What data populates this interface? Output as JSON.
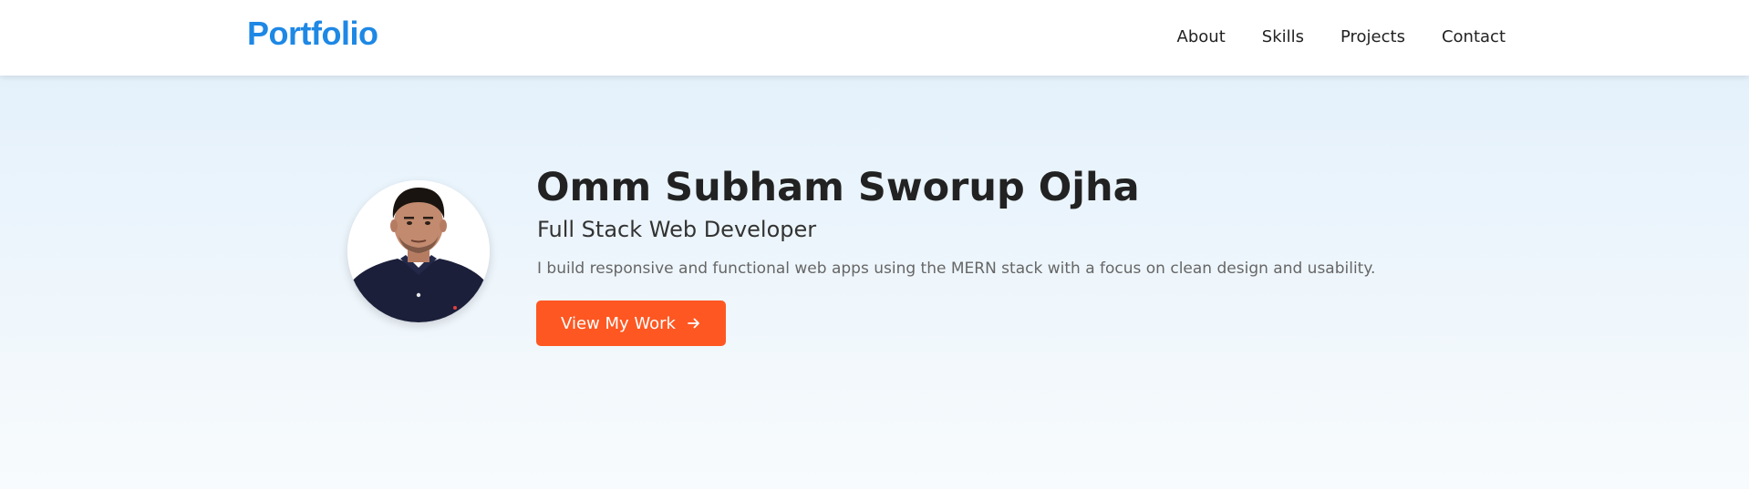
{
  "navbar": {
    "brand": "Portfolio",
    "links": [
      {
        "label": "About"
      },
      {
        "label": "Skills"
      },
      {
        "label": "Projects"
      },
      {
        "label": "Contact"
      }
    ]
  },
  "hero": {
    "name": "Omm Subham Sworup Ojha",
    "role": "Full Stack Web Developer",
    "description": "I build responsive and functional web apps using the MERN stack with a focus on clean design and usability.",
    "cta_label": "View My Work",
    "cta_icon": "arrow-right-icon",
    "avatar_alt": "profile photo"
  },
  "colors": {
    "brand": "#1e88e5",
    "cta": "#ff5722",
    "hero_gradient_top": "#e4f1fb",
    "hero_gradient_bottom": "#f8fbfd",
    "heading_text": "#222222",
    "body_text": "#666666"
  }
}
